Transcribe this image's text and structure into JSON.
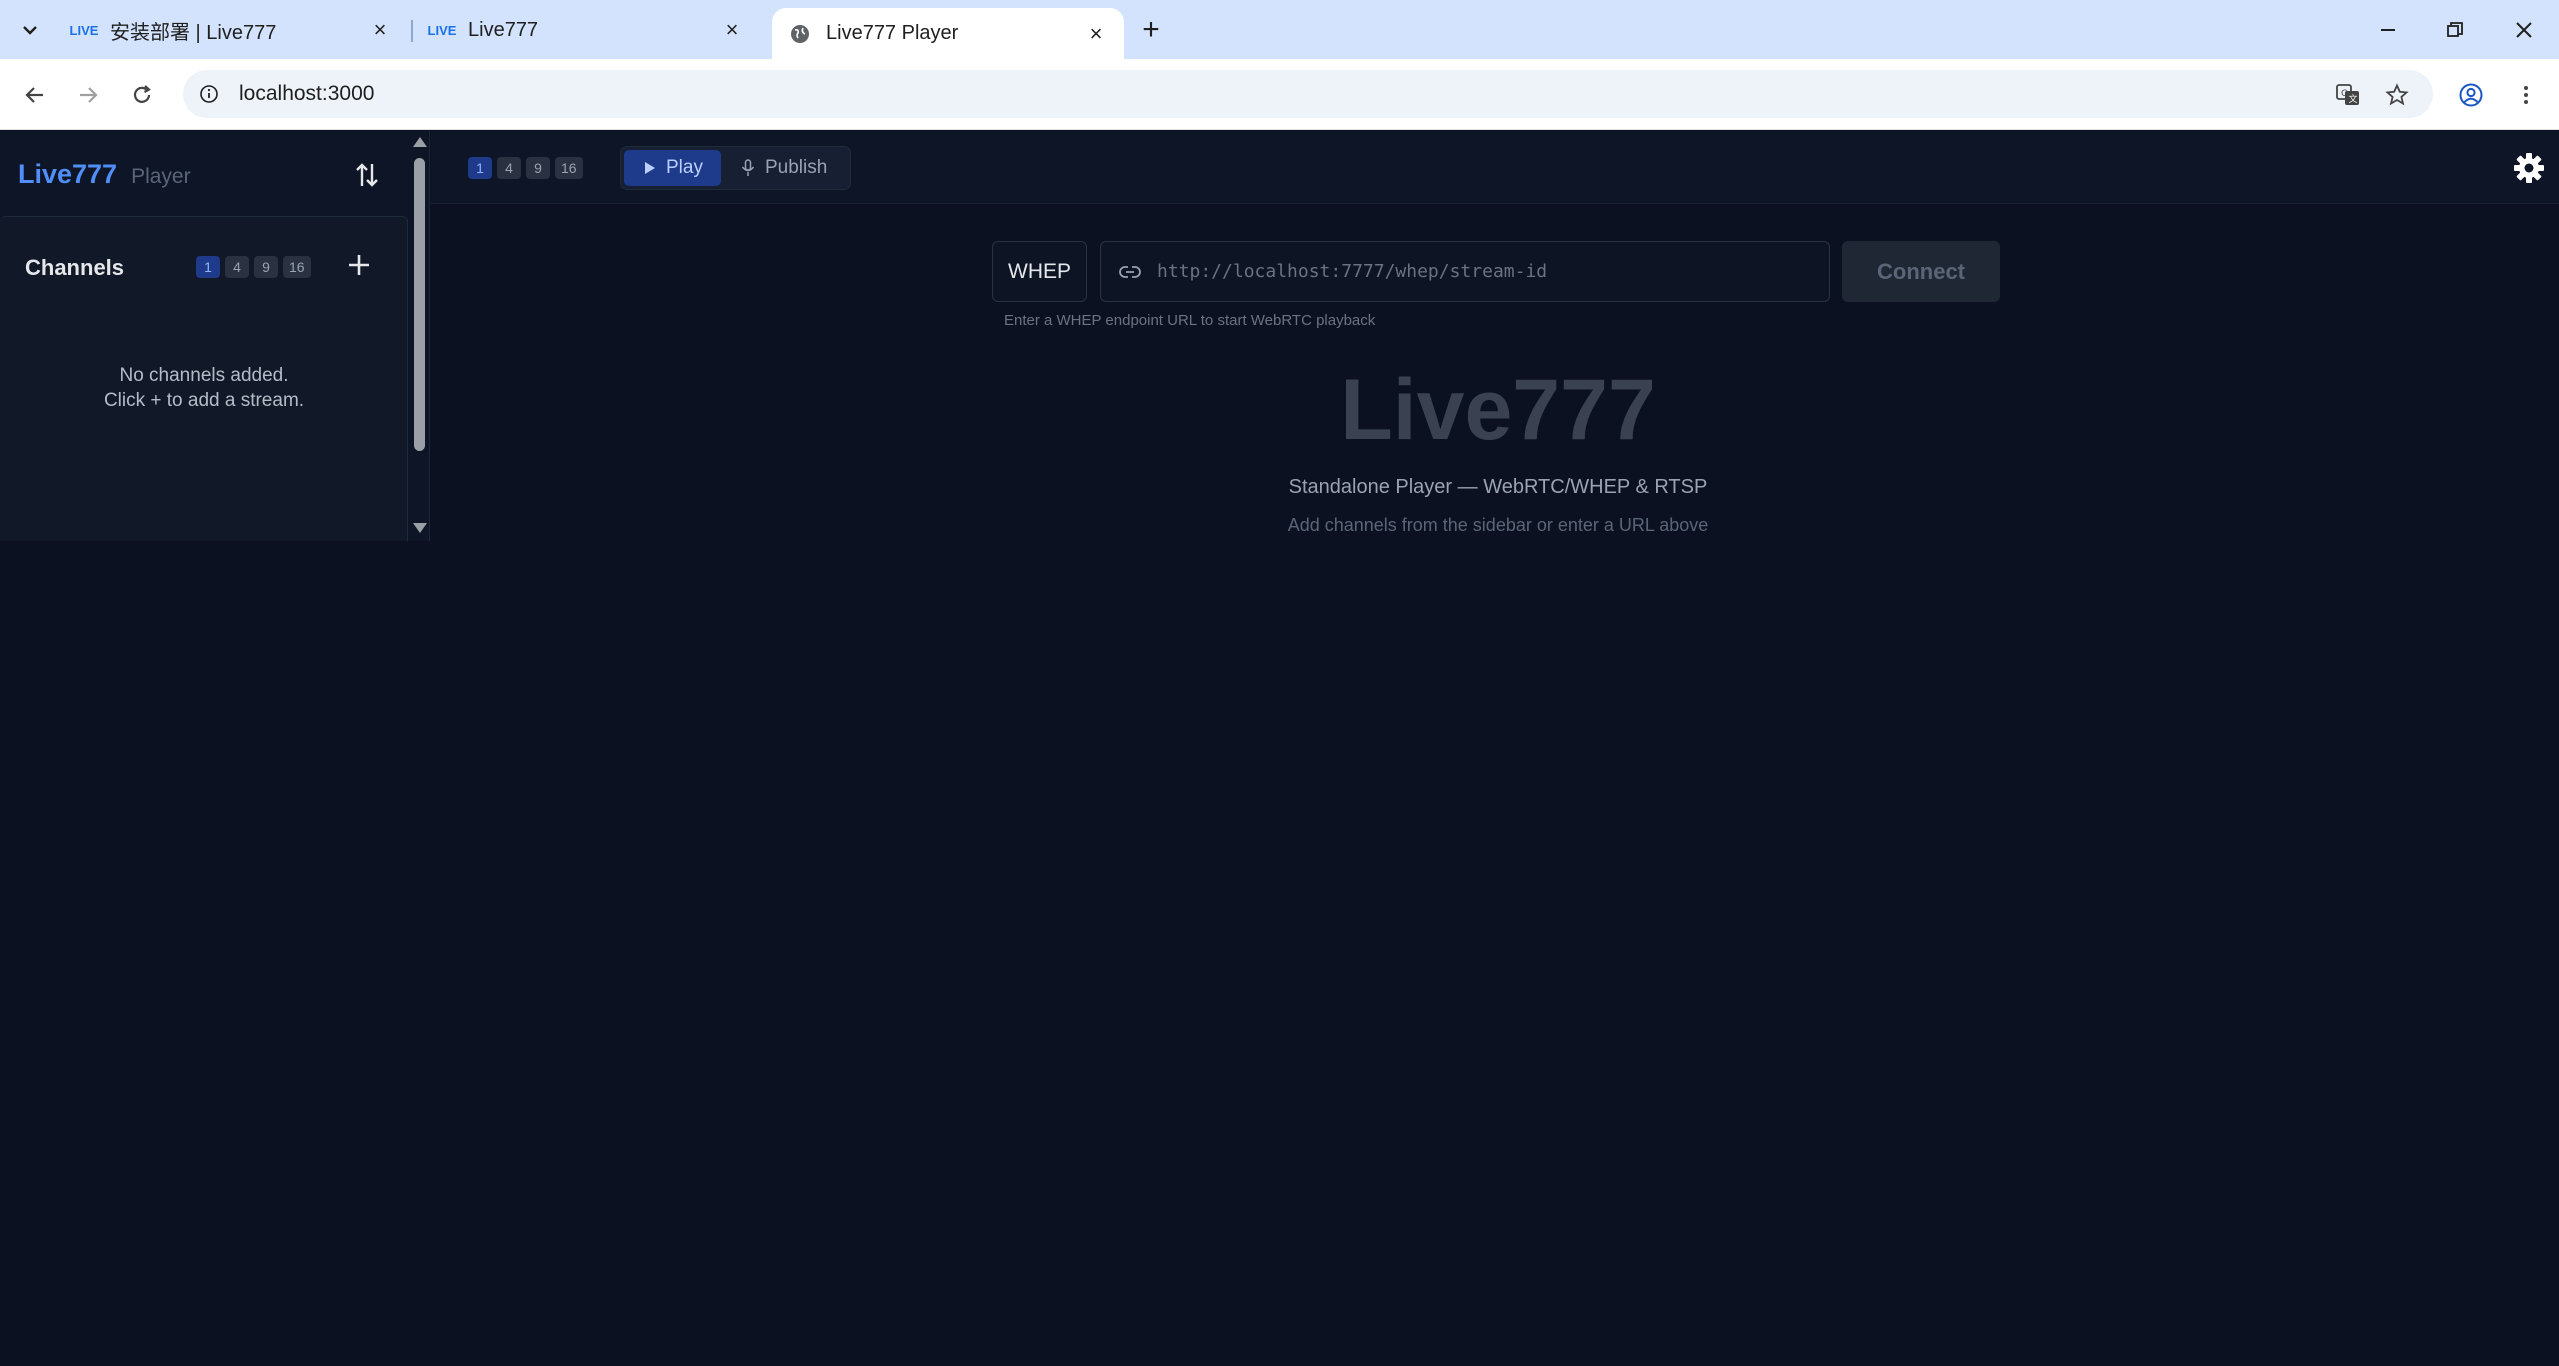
{
  "browser": {
    "tabs": [
      {
        "title": "安装部署 | Live777",
        "favicon": "live777-logo"
      },
      {
        "title": "Live777",
        "favicon": "live777-logo"
      },
      {
        "title": "Live777 Player",
        "favicon": "globe-icon",
        "active": true
      }
    ],
    "favicon_text": "LIVE",
    "url": "localhost:3000"
  },
  "sidebar": {
    "brand": "Live777",
    "brand_sub": "Player",
    "channels_title": "Channels",
    "grid_options": [
      "1",
      "4",
      "9",
      "16"
    ],
    "grid_selected": "1",
    "empty_line1": "No channels added.",
    "empty_line2": "Click + to add a stream."
  },
  "topbar": {
    "grid_options": [
      "1",
      "4",
      "9",
      "16"
    ],
    "grid_selected": "1",
    "play_label": "Play",
    "publish_label": "Publish",
    "mode_selected": "Play"
  },
  "connect": {
    "protocol": "WHEP",
    "url_value": "",
    "url_placeholder": "http://localhost:7777/whep/stream-id",
    "connect_label": "Connect",
    "hint": "Enter a WHEP endpoint URL to start WebRTC playback"
  },
  "hero": {
    "title": "Live777",
    "subtitle": "Standalone Player — WebRTC/WHEP & RTSP",
    "note": "Add channels from the sidebar or enter a URL above"
  },
  "colors": {
    "accent": "#4f8ff7",
    "background": "#0b1120",
    "tabbar": "#d3e3fd"
  }
}
